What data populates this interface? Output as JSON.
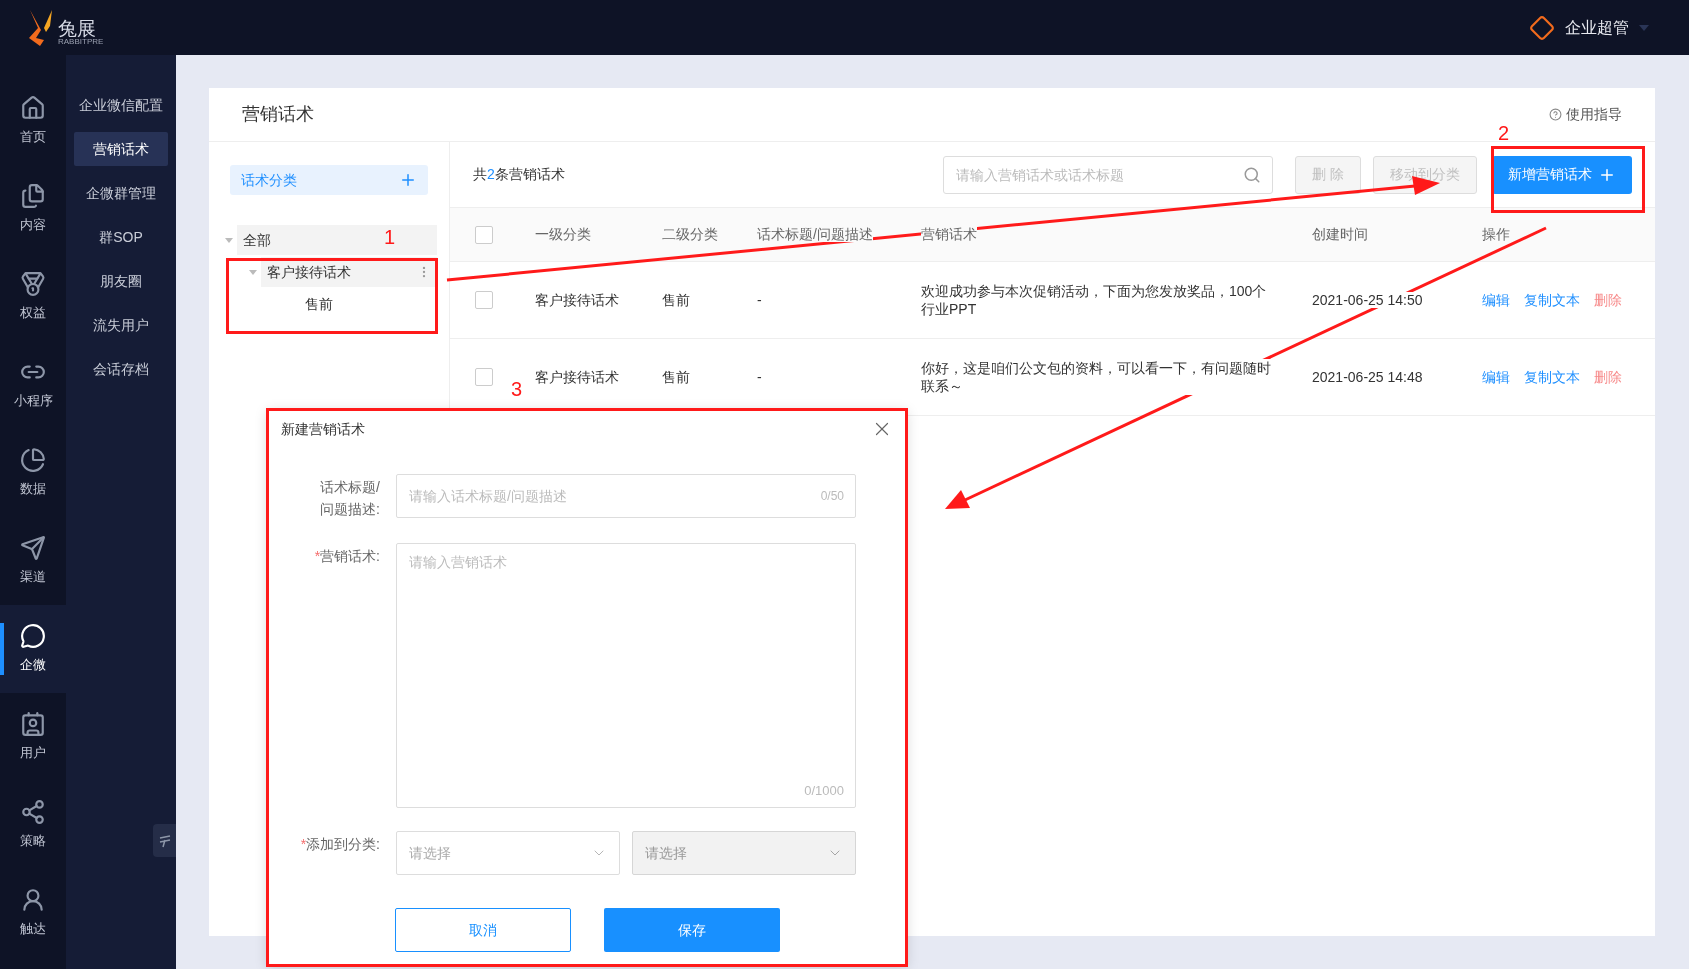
{
  "brand": {
    "name": "兔展",
    "tagline": "RABBITPRE"
  },
  "user": {
    "name": "企业超管"
  },
  "rail": [
    {
      "label": "首页",
      "selected": false
    },
    {
      "label": "内容",
      "selected": false
    },
    {
      "label": "权益",
      "selected": false
    },
    {
      "label": "小程序",
      "selected": false
    },
    {
      "label": "数据",
      "selected": false
    },
    {
      "label": "渠道",
      "selected": false
    },
    {
      "label": "企微",
      "selected": true
    },
    {
      "label": "用户",
      "selected": false
    },
    {
      "label": "策略",
      "selected": false
    },
    {
      "label": "触达",
      "selected": false
    }
  ],
  "subnav": [
    {
      "label": "企业微信配置",
      "selected": false
    },
    {
      "label": "营销话术",
      "selected": true
    },
    {
      "label": "企微群管理",
      "selected": false
    },
    {
      "label": "群SOP",
      "selected": false
    },
    {
      "label": "朋友圈",
      "selected": false
    },
    {
      "label": "流失用户",
      "selected": false
    },
    {
      "label": "会话存档",
      "selected": false
    }
  ],
  "page": {
    "title": "营销话术",
    "help": "使用指导"
  },
  "categories": {
    "button": "话术分类",
    "tree": [
      {
        "label": "全部",
        "expanded": true,
        "children": [
          {
            "label": "客户接待话术",
            "expanded": true,
            "children": [
              {
                "label": "售前"
              }
            ]
          }
        ]
      }
    ]
  },
  "toolbar": {
    "count_prefix": "共",
    "count": "2",
    "count_suffix": "条营销话术",
    "search_placeholder": "请输入营销话术或话术标题",
    "buttons": [
      {
        "label": "删 除",
        "kind": "default",
        "disabled": true
      },
      {
        "label": "移动到分类",
        "kind": "default",
        "disabled": true
      },
      {
        "label": "新增营销话术",
        "kind": "primary",
        "disabled": false
      }
    ]
  },
  "table": {
    "all_checked": false,
    "columns": [
      "一级分类",
      "二级分类",
      "话术标题/问题描述",
      "营销话术",
      "创建时间",
      "操作"
    ],
    "rows": [
      {
        "checked": false,
        "cells": [
          "客户接待话术",
          "售前",
          "-",
          "欢迎成功参与本次促销活动，下面为您发放奖品，100个行业PPT",
          "2021-06-25 14:50"
        ],
        "actions": [
          {
            "label": "编辑",
            "kind": "link"
          },
          {
            "label": "复制文本",
            "kind": "link"
          },
          {
            "label": "删除",
            "kind": "danger"
          }
        ]
      },
      {
        "checked": false,
        "cells": [
          "客户接待话术",
          "售前",
          "-",
          "你好，这是咱们公文包的资料，可以看一下，有问题随时联系～",
          "2021-06-25 14:48"
        ],
        "actions": [
          {
            "label": "编辑",
            "kind": "link"
          },
          {
            "label": "复制文本",
            "kind": "link"
          },
          {
            "label": "删除",
            "kind": "danger"
          }
        ]
      }
    ]
  },
  "dialog": {
    "title": "新建营销话术",
    "fields": [
      {
        "kind": "input",
        "label_lines": [
          "话术标题/",
          "问题描述:"
        ],
        "placeholder": "请输入话术标题/问题描述",
        "counter": "0/50"
      },
      {
        "kind": "textarea",
        "required_mark": "*",
        "label_lines": [
          "营销话术:"
        ],
        "placeholder": "请输入营销话术",
        "counter": "0/1000"
      },
      {
        "kind": "selects",
        "required_mark": "*",
        "label_lines": [
          "添加到分类:"
        ],
        "selects": [
          {
            "placeholder": "请选择",
            "disabled": false
          },
          {
            "placeholder": "请选择",
            "disabled": true
          }
        ]
      }
    ],
    "cancel": "取消",
    "save": "保存"
  },
  "annotations": [
    {
      "label": "1"
    },
    {
      "label": "2"
    },
    {
      "label": "3"
    }
  ]
}
